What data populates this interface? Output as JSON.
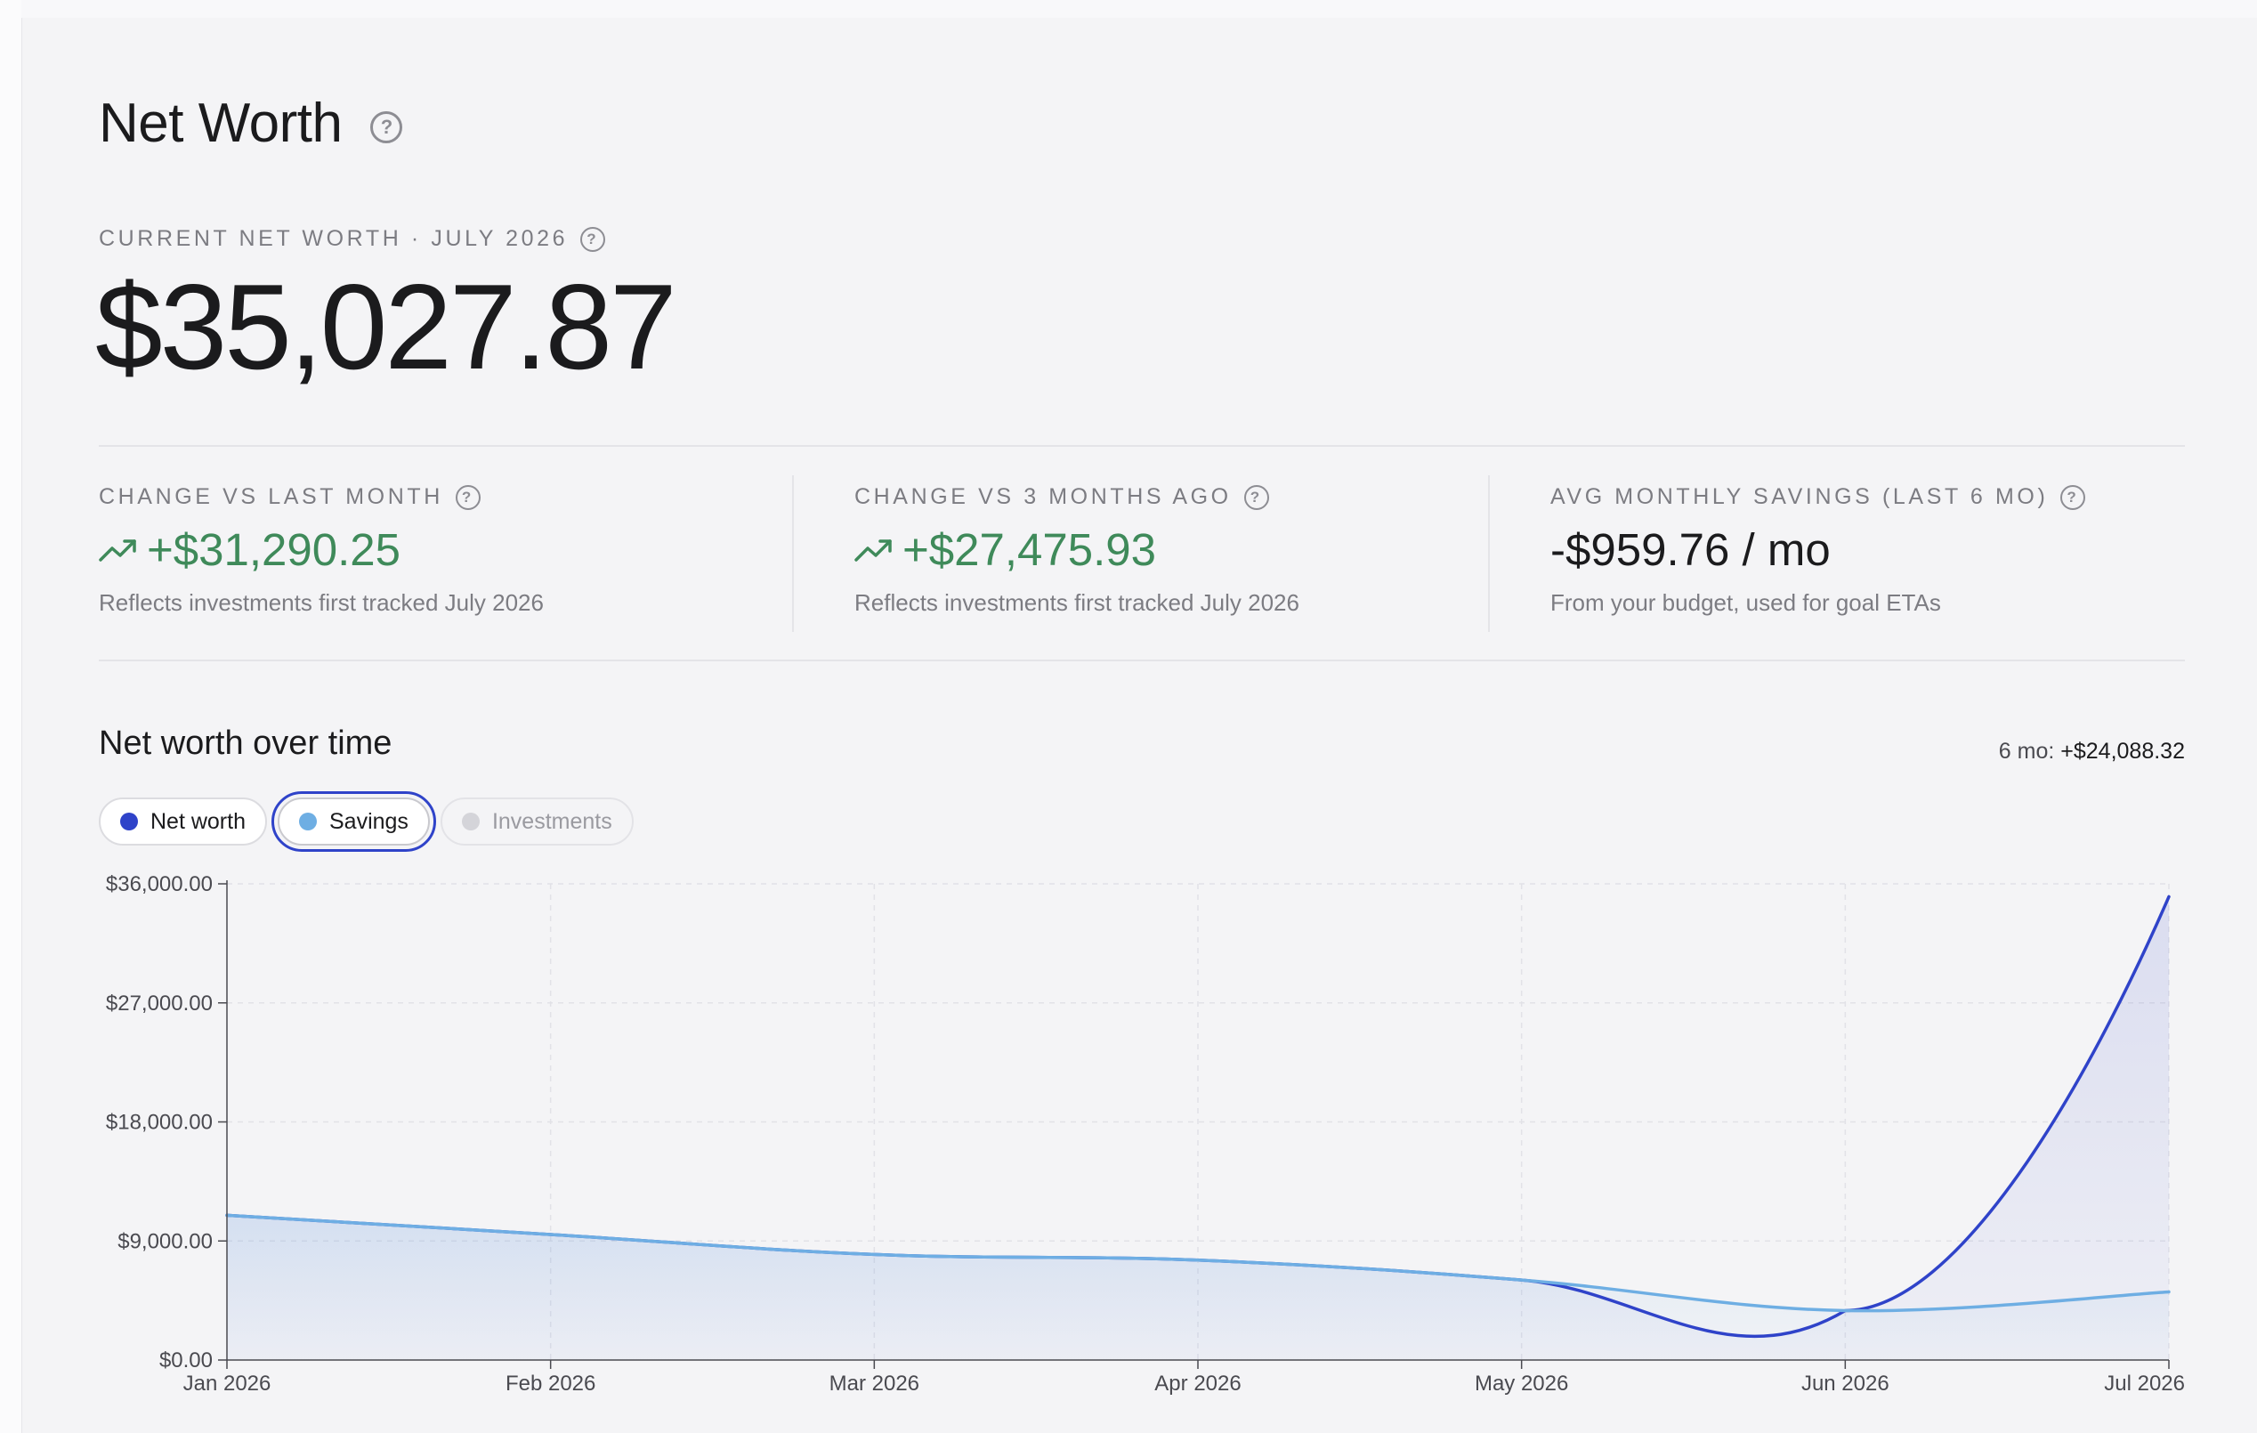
{
  "page": {
    "title": "Net Worth",
    "title_help": "?"
  },
  "current": {
    "label": "CURRENT NET WORTH · JULY 2026",
    "help": "?",
    "amount": "$35,027.87"
  },
  "stats": [
    {
      "label": "CHANGE VS LAST MONTH",
      "help": "?",
      "value": "+$31,290.25",
      "trend": "up",
      "note": "Reflects investments first tracked July 2026"
    },
    {
      "label": "CHANGE VS 3 MONTHS AGO",
      "help": "?",
      "value": "+$27,475.93",
      "trend": "up",
      "note": "Reflects investments first tracked July 2026"
    },
    {
      "label": "AVG MONTHLY SAVINGS (LAST 6 MO)",
      "help": "?",
      "value": "-$959.76 / mo",
      "note": "From your budget, used for goal ETAs"
    }
  ],
  "chart_section": {
    "title": "Net worth over time",
    "summary_label": "6 mo:",
    "summary_value": "+$24,088.32"
  },
  "legend": [
    {
      "label": "Net worth",
      "color": "#2f43c9",
      "active": true
    },
    {
      "label": "Savings",
      "color": "#6eaee3",
      "active": true,
      "focused": true
    },
    {
      "label": "Investments",
      "color": "#d4d4d9",
      "active": false
    }
  ],
  "colors": {
    "positive": "#3f8a5a",
    "net_worth_line": "#2f43c9",
    "savings_line": "#6eaee3"
  },
  "chart_data": {
    "type": "line",
    "categories": [
      "Jan 2026",
      "Feb 2026",
      "Mar 2026",
      "Apr 2026",
      "May 2026",
      "Jun 2026",
      "Jul 2026"
    ],
    "series": [
      {
        "name": "Net worth",
        "values": [
          10939,
          9490,
          7980,
          7550,
          6050,
          3737,
          35027.87
        ]
      },
      {
        "name": "Savings",
        "values": [
          10939,
          9490,
          7980,
          7550,
          6050,
          3737,
          5150
        ]
      }
    ],
    "y_ticks": [
      "$0.00",
      "$9,000.00",
      "$18,000.00",
      "$27,000.00",
      "$36,000.00"
    ],
    "ylim": [
      0,
      36000
    ],
    "grid": true,
    "area_fill": true
  }
}
